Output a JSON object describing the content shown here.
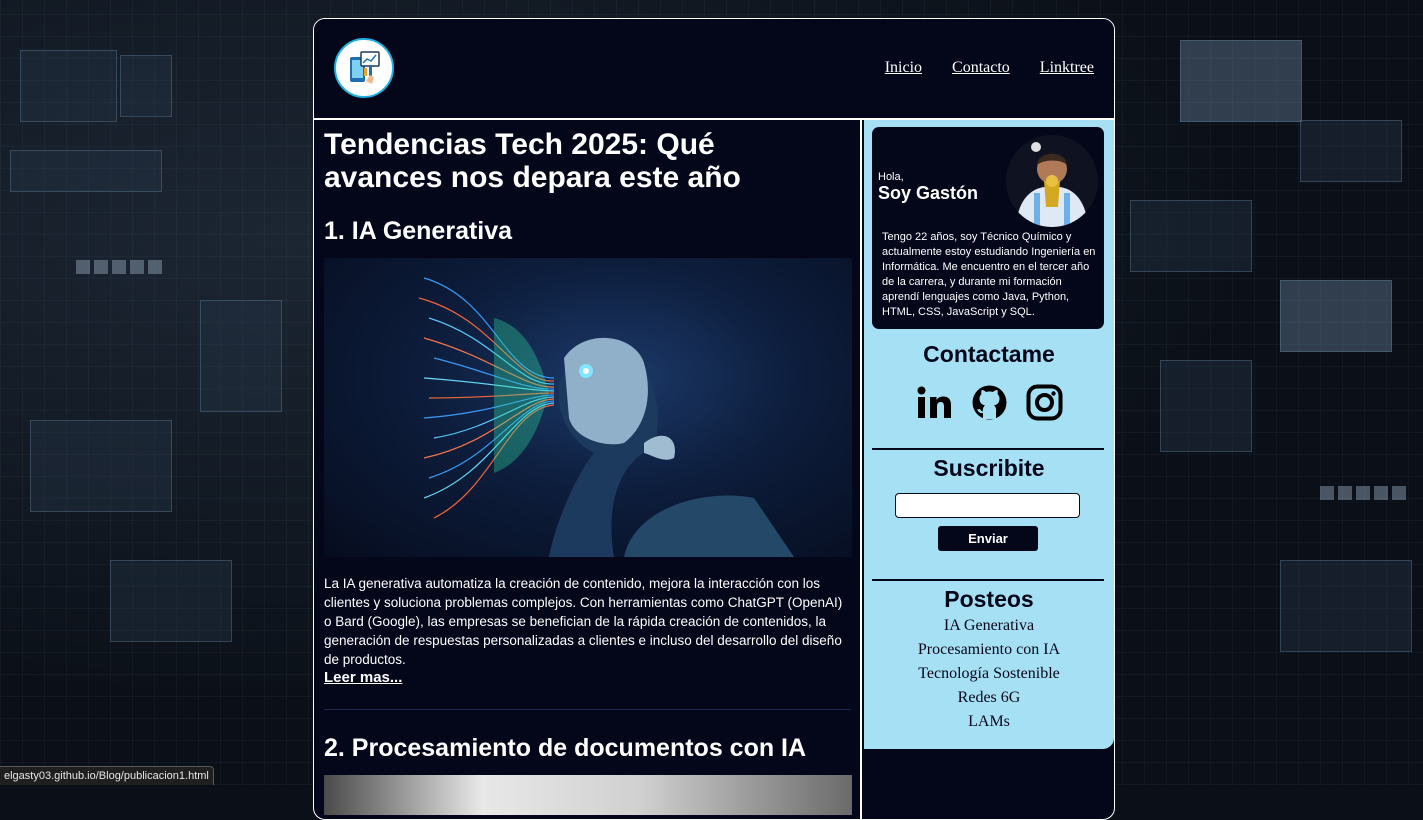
{
  "header": {
    "logo_icon": "phone-chart-icon",
    "nav": [
      "Inicio",
      "Contacto",
      "Linktree"
    ]
  },
  "article": {
    "title_line1": "Tendencias Tech 2025: Qué",
    "title_line2": "avances nos depara este año",
    "section1_heading": "1. IA Generativa",
    "section1_body": "La IA generativa automatiza la creación de contenido, mejora la interacción con los clientes y soluciona problemas complejos. Con herramientas como ChatGPT (OpenAI) o Bard (Google), las empresas se benefician de la rápida creación de contenidos, la generación de respuestas personalizadas a clientes e incluso del desarrollo del diseño de productos.",
    "read_more": "Leer mas...",
    "section2_heading": "2. Procesamiento de documentos con IA"
  },
  "sidebar": {
    "greeting": "Hola,",
    "name": "Soy Gastón",
    "bio": "Tengo 22 años, soy Técnico Químico y actualmente estoy estudiando Ingeniería en Informática. Me encuentro en el tercer año de la carrera, y durante mi formación aprendí lenguajes como Java, Python, HTML, CSS, JavaScript y SQL.",
    "contact_heading": "Contactame",
    "social_icons": [
      "linkedin-icon",
      "github-icon",
      "instagram-icon"
    ],
    "subscribe_heading": "Suscribite",
    "email_value": "",
    "send_label": "Enviar",
    "posts_heading": "Posteos",
    "posts": [
      "IA Generativa",
      "Procesamiento con IA",
      "Tecnología Sostenible",
      "Redes 6G",
      "LAMs"
    ]
  },
  "status_bar": {
    "url": "elgasty03.github.io/Blog/publicacion1.html"
  },
  "colors": {
    "page_bg": "#04061a",
    "sidebar_bg": "#a6e0f5",
    "accent": "#1db0e0"
  }
}
